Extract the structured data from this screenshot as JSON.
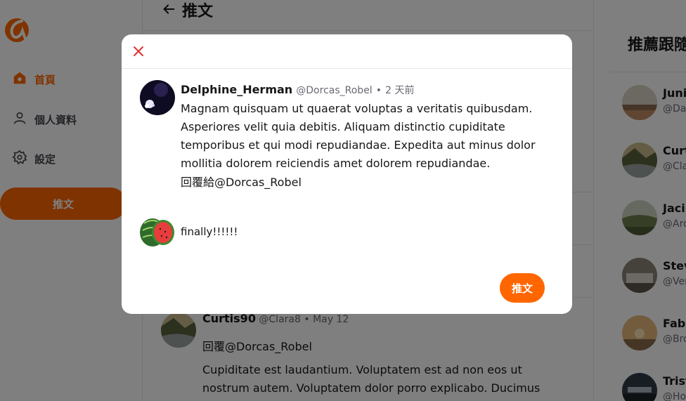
{
  "colors": {
    "accent": "#ff6600",
    "overlay": "rgba(0,0,0,0.5)",
    "close": "#e0332f"
  },
  "sidebar": {
    "logo_icon": "brand-logo-icon",
    "items": [
      {
        "label": "首頁",
        "icon": "home-icon",
        "active": true
      },
      {
        "label": "個人資料",
        "icon": "user-icon",
        "active": false
      },
      {
        "label": "設定",
        "icon": "gear-icon",
        "active": false
      }
    ],
    "tweet_button": "推文"
  },
  "main": {
    "back_icon": "arrow-left-icon",
    "title": "推文",
    "bg_tweet": {
      "name": "Curtis90",
      "handle": "@Clara8",
      "time": "May 12",
      "reply_to": "回覆@Dorcas_Robel",
      "body": "Cupiditate est laudantium. Voluptatem est ad non eos ut nostrum autem. Voluptatem dolor porro explicabo. Ducimus voluptatum"
    }
  },
  "right": {
    "title": "推薦跟隨",
    "users": [
      {
        "name": "Juni",
        "handle": "@Dap"
      },
      {
        "name": "Curt",
        "handle": "@Cla"
      },
      {
        "name": "Jaci",
        "handle": "@Aro"
      },
      {
        "name": "Stev",
        "handle": "@Ver"
      },
      {
        "name": "Fabi",
        "handle": "@Bro"
      },
      {
        "name": "Trist",
        "handle": "@Ho"
      }
    ]
  },
  "modal": {
    "close_icon": "close-icon",
    "tweet": {
      "name": "Delphine_Herman",
      "handle": "@Dorcas_Robel",
      "time": "2 天前",
      "body": "Magnam quisquam ut quaerat voluptas a veritatis quibusdam. Asperiores velit quia debitis. Aliquam distinctio cupiditate temporibus et qui modi repudiandae. Expedita aut minus dolor mollitia dolorem reiciendis amet dolorem repudiandae.",
      "reply_to": "回覆給@Dorcas_Robel"
    },
    "reply": {
      "value": "finally!!!!!!",
      "avatar_icon": "watermelon-avatar-icon"
    },
    "submit_label": "推文"
  }
}
